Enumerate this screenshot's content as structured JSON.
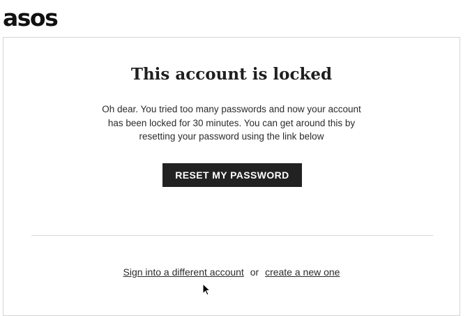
{
  "brand": {
    "logo_text": "asos"
  },
  "lock_notice": {
    "title": "This account is locked",
    "message_lines": [
      "Oh dear. You tried too many passwords and now your account",
      "has been locked for 30 minutes. You can get around this by",
      "resetting your password using the link below"
    ],
    "reset_button_label": "RESET MY PASSWORD"
  },
  "alternatives": {
    "sign_in_link": "Sign into a different account",
    "separator": "or",
    "create_link": "create a new one"
  },
  "colors": {
    "button_bg": "#222222",
    "button_text": "#ffffff",
    "panel_border": "#d4d4d4"
  },
  "icons": {
    "cursor": "mouse-pointer-icon"
  }
}
